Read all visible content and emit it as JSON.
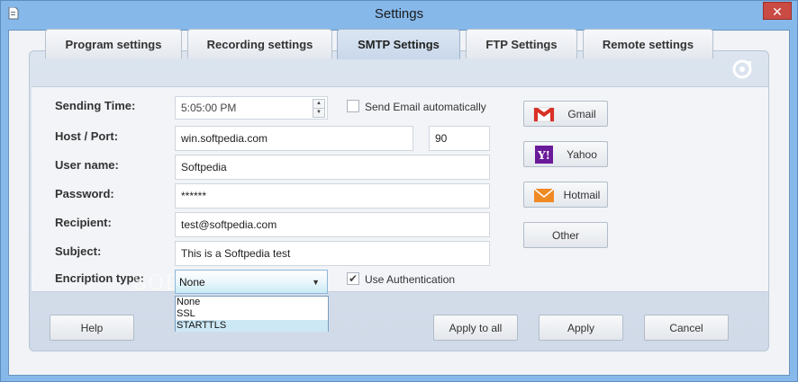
{
  "window": {
    "title": "Settings",
    "close_glyph": "✕"
  },
  "tabs": [
    {
      "label": "Program settings"
    },
    {
      "label": "Recording settings"
    },
    {
      "label": "SMTP Settings",
      "active": true
    },
    {
      "label": "FTP Settings"
    },
    {
      "label": "Remote settings"
    }
  ],
  "form": {
    "sending_time_label": "Sending Time:",
    "sending_time_value": "5:05:00 PM",
    "send_email_auto_label": "Send Email automatically",
    "send_email_auto_checked": false,
    "host_port_label": "Host / Port:",
    "host_value": "win.softpedia.com",
    "port_value": "90",
    "username_label": "User name:",
    "username_value": "Softpedia",
    "password_label": "Password:",
    "password_value": "******",
    "recipient_label": "Recipient:",
    "recipient_value": "test@softpedia.com",
    "subject_label": "Subject:",
    "subject_value": "This is a Softpedia test",
    "encryption_label": "Encription type:",
    "encryption_value": "None",
    "encryption_options": [
      "None",
      "SSL",
      "STARTTLS"
    ],
    "use_auth_label": "Use Authentication",
    "use_auth_checked": true
  },
  "providers": {
    "gmail": "Gmail",
    "yahoo": "Yahoo",
    "hotmail": "Hotmail",
    "other": "Other"
  },
  "footer": {
    "help": "Help",
    "apply_all": "Apply to all",
    "apply": "Apply",
    "cancel": "Cancel"
  },
  "watermark": "SOFTPEDIA",
  "colors": {
    "gmail_red": "#d93025",
    "yahoo_purple": "#6a1b9a",
    "hotmail_orange": "#f08a24"
  }
}
